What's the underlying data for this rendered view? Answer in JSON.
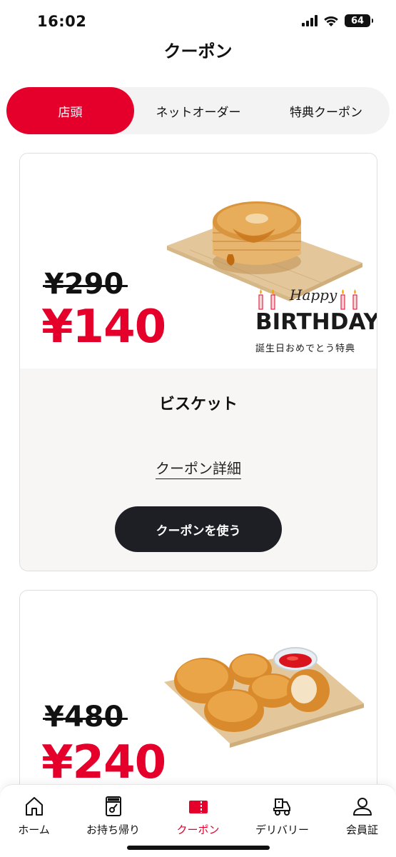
{
  "status_bar": {
    "time": "16:02",
    "battery": "64",
    "icons": [
      "signal-icon",
      "wifi-icon",
      "battery-icon"
    ]
  },
  "header": {
    "title": "クーポン"
  },
  "tabs": [
    {
      "label": "店頭",
      "active": true
    },
    {
      "label": "ネットオーダー",
      "active": false
    },
    {
      "label": "特典クーポン",
      "active": false
    }
  ],
  "coupons": [
    {
      "old_price": "¥290",
      "new_price": "¥140",
      "product_name": "ビスケット",
      "detail_link": "クーポン詳細",
      "use_button": "クーポンを使う",
      "birthday": {
        "happy": "Happy",
        "title": "BIRTHDAY",
        "subtitle": "誕生日おめでとう特典"
      }
    },
    {
      "old_price": "¥480",
      "new_price": "¥240"
    }
  ],
  "bottom_nav": [
    {
      "label": "ホーム",
      "icon": "home-icon",
      "active": false
    },
    {
      "label": "お持ち帰り",
      "icon": "menu-takeout-icon",
      "active": false
    },
    {
      "label": "クーポン",
      "icon": "coupon-icon",
      "active": true
    },
    {
      "label": "デリバリー",
      "icon": "delivery-icon",
      "active": false
    },
    {
      "label": "会員証",
      "icon": "member-icon",
      "active": false
    }
  ],
  "colors": {
    "accent": "#e4002b",
    "dark_button": "#1e1f24",
    "tab_bg": "#f3f3f3"
  }
}
